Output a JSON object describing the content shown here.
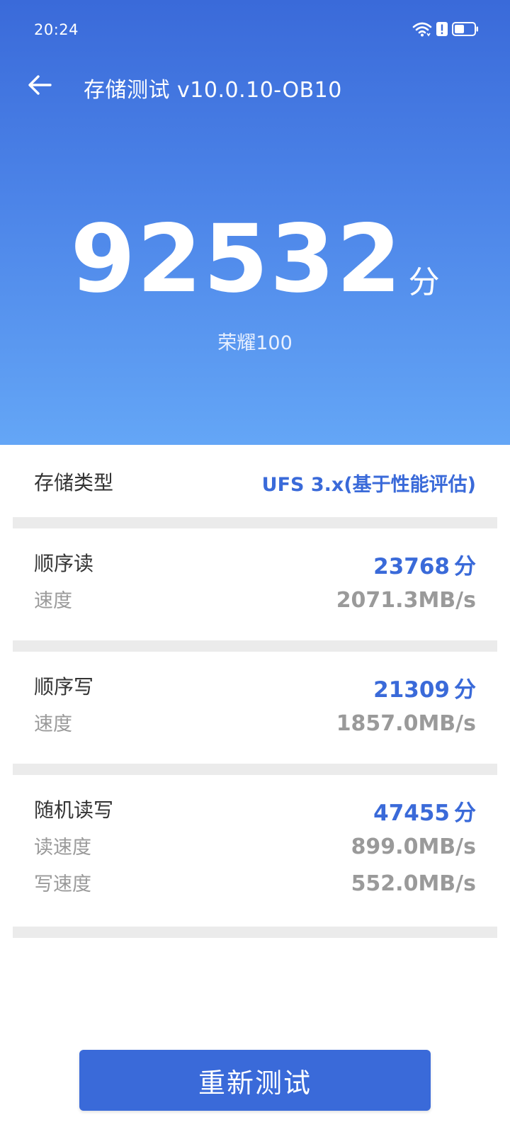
{
  "status_bar": {
    "time": "20:24",
    "icons": [
      "wifi-icon",
      "alert-icon",
      "battery-icon"
    ]
  },
  "header": {
    "title": "存储测试 v10.0.10-OB10",
    "back_icon": "arrow-left-icon"
  },
  "summary": {
    "score": "92532",
    "score_unit": "分",
    "device": "荣耀100"
  },
  "storage_type": {
    "label": "存储类型",
    "value": "UFS 3.x(基于性能评估)"
  },
  "sequential_read": {
    "label": "顺序读",
    "score": "23768",
    "score_unit": "分",
    "speed_label": "速度",
    "speed": "2071.3MB/s"
  },
  "sequential_write": {
    "label": "顺序写",
    "score": "21309",
    "score_unit": "分",
    "speed_label": "速度",
    "speed": "1857.0MB/s"
  },
  "random_rw": {
    "label": "随机读写",
    "score": "47455",
    "score_unit": "分",
    "read_label": "读速度",
    "read_speed": "899.0MB/s",
    "write_label": "写速度",
    "write_speed": "552.0MB/s"
  },
  "actions": {
    "retest_label": "重新测试"
  },
  "colors": {
    "accent": "#3a6ad9",
    "hero_top": "#3a6ad9",
    "hero_bottom": "#64a6f6",
    "muted_text": "#9a9a9a",
    "divider": "#ebebeb"
  }
}
